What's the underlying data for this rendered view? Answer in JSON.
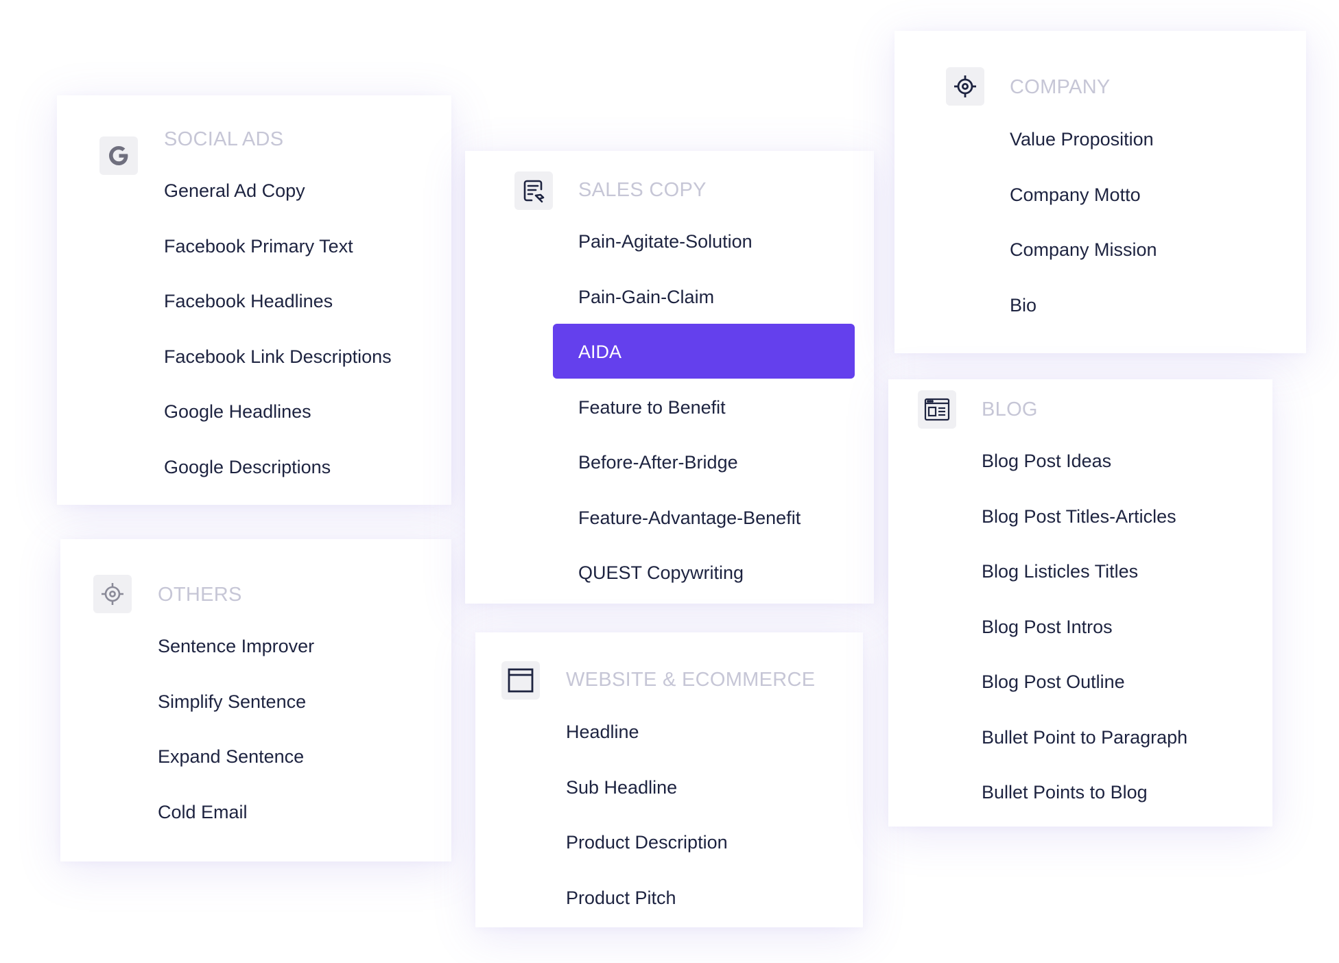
{
  "colors": {
    "accent": "#6440ed",
    "heading": "#c6c6d6",
    "item_text": "#1d2340",
    "icon_bg": "#f0f0f3"
  },
  "sections": {
    "social_ads": {
      "icon": "google-icon",
      "title": "SOCIAL ADS",
      "items": [
        {
          "label": "General Ad Copy"
        },
        {
          "label": "Facebook Primary Text"
        },
        {
          "label": "Facebook Headlines"
        },
        {
          "label": "Facebook Link Descriptions"
        },
        {
          "label": "Google Headlines"
        },
        {
          "label": "Google Descriptions"
        }
      ]
    },
    "others": {
      "icon": "target-icon",
      "title": "OTHERS",
      "items": [
        {
          "label": "Sentence Improver"
        },
        {
          "label": "Simplify Sentence"
        },
        {
          "label": "Expand Sentence"
        },
        {
          "label": "Cold Email"
        }
      ]
    },
    "sales_copy": {
      "icon": "document-edit-icon",
      "title": "SALES COPY",
      "items": [
        {
          "label": "Pain-Agitate-Solution"
        },
        {
          "label": "Pain-Gain-Claim"
        },
        {
          "label": "AIDA",
          "selected": true
        },
        {
          "label": "Feature to Benefit"
        },
        {
          "label": "Before-After-Bridge"
        },
        {
          "label": "Feature-Advantage-Benefit"
        },
        {
          "label": "QUEST Copywriting"
        }
      ]
    },
    "website": {
      "icon": "browser-window-icon",
      "title": "WEBSITE & ECOMMERCE",
      "items": [
        {
          "label": "Headline"
        },
        {
          "label": "Sub Headline"
        },
        {
          "label": "Product Description"
        },
        {
          "label": "Product Pitch"
        }
      ]
    },
    "company": {
      "icon": "target-icon",
      "title": "COMPANY",
      "items": [
        {
          "label": "Value Proposition"
        },
        {
          "label": "Company Motto"
        },
        {
          "label": "Company Mission"
        },
        {
          "label": "Bio"
        }
      ]
    },
    "blog": {
      "icon": "blog-layout-icon",
      "title": "BLOG",
      "items": [
        {
          "label": "Blog Post Ideas"
        },
        {
          "label": "Blog Post Titles-Articles"
        },
        {
          "label": "Blog Listicles Titles"
        },
        {
          "label": "Blog Post Intros"
        },
        {
          "label": "Blog Post Outline"
        },
        {
          "label": "Bullet Point to Paragraph"
        },
        {
          "label": "Bullet Points to Blog"
        }
      ]
    }
  }
}
